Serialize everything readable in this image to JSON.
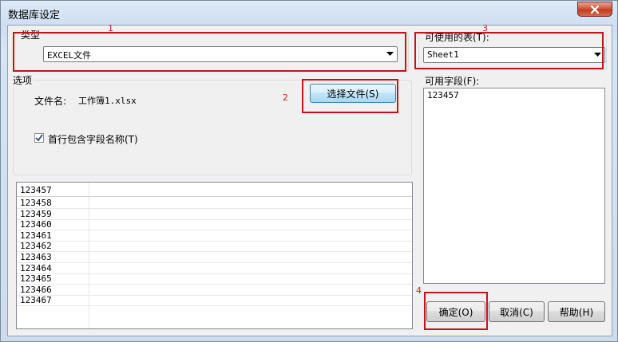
{
  "window": {
    "title": "数据库设定"
  },
  "type_group": {
    "label": "类型",
    "selected": "EXCEL文件"
  },
  "options_group": {
    "label": "选项",
    "filename_label": "文件名:",
    "filename_value": "工作簿1.xlsx",
    "choose_file_button": "选择文件(S)",
    "header_checkbox_label": "首行包含字段名称(T)",
    "header_checkbox_checked": true
  },
  "tables": {
    "label": "可使用的表(T):",
    "selected": "Sheet1"
  },
  "fields": {
    "label": "可用字段(F):",
    "items": [
      "123457"
    ]
  },
  "grid": {
    "header": "123457",
    "rows": [
      "123458",
      "123459",
      "123460",
      "123461",
      "123462",
      "123463",
      "123464",
      "123465",
      "123466",
      "123467"
    ]
  },
  "buttons": {
    "ok": "确定(O)",
    "cancel": "取消(C)",
    "help": "帮助(H)"
  },
  "annotations": {
    "n1": "1",
    "n2": "2",
    "n3": "3",
    "n4": "4",
    "color": "#c0161b"
  }
}
